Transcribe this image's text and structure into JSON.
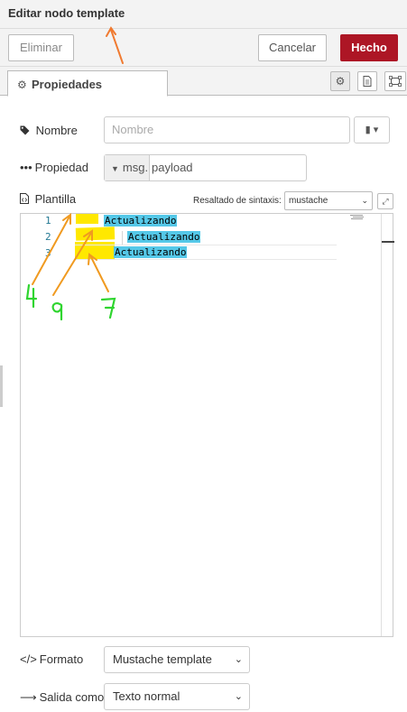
{
  "dialog": {
    "title": "Editar nodo template"
  },
  "toolbar": {
    "delete_label": "Eliminar",
    "cancel_label": "Cancelar",
    "done_label": "Hecho"
  },
  "tabs": {
    "properties_label": "Propiedades"
  },
  "fields": {
    "name": {
      "label": "Nombre",
      "placeholder": "Nombre"
    },
    "property": {
      "label": "Propiedad",
      "type_prefix": "msg.",
      "value": "payload"
    },
    "template": {
      "label": "Plantilla",
      "syntax_label": "Resaltado de sintaxis:",
      "syntax_value": "mustache",
      "lines": [
        {
          "number": "1",
          "text": "Actualizando"
        },
        {
          "number": "2",
          "text": "Actualizando"
        },
        {
          "number": "3",
          "text": "Actualizando"
        }
      ]
    },
    "format": {
      "label": "Formato",
      "value": "Mustache template"
    },
    "output": {
      "label": "Salida como",
      "value": "Texto normal"
    }
  },
  "annotations": {
    "arrow_labels": [
      "4",
      "9",
      "7"
    ]
  },
  "colors": {
    "done_button": "#ad1625",
    "arrow": "#f07a30",
    "handwriting": "#2fd52f",
    "highlight_yellow": "#ffe800",
    "highlight_cyan": "#55c8e8"
  },
  "icons": [
    "gear-icon",
    "document-icon",
    "frame-icon",
    "tag-icon",
    "ellipsis-icon",
    "file-code-icon",
    "book-icon",
    "code-icon",
    "arrow-right-icon",
    "expand-icon"
  ]
}
